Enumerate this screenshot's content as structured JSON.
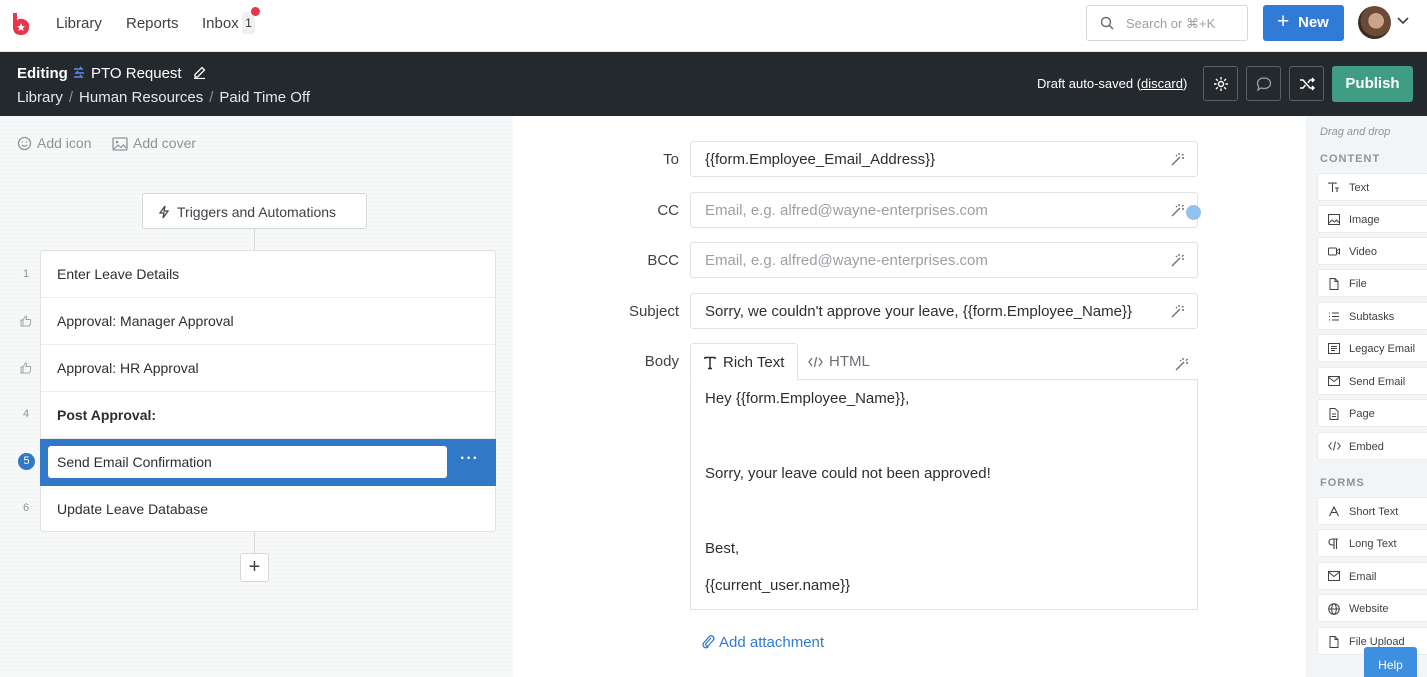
{
  "topnav": {
    "links": [
      "Library",
      "Reports",
      "Inbox"
    ],
    "inbox_count": "1",
    "search_placeholder": "Search or ⌘+K",
    "new_label": "New"
  },
  "editor_header": {
    "mode": "Editing",
    "title": "PTO Request",
    "breadcrumbs": [
      "Library",
      "Human Resources",
      "Paid Time Off"
    ],
    "autosave_text": "Draft auto-saved (",
    "discard_label": "discard",
    "autosave_close": ")",
    "publish_label": "Publish"
  },
  "left": {
    "add_icon_label": "Add icon",
    "add_cover_label": "Add cover",
    "triggers_label": "Triggers and Automations",
    "steps": [
      {
        "num": "1",
        "label": "Enter Leave Details"
      },
      {
        "num": "",
        "label": "Approval: Manager Approval",
        "icon": "thumbs-up-icon"
      },
      {
        "num": "",
        "label": "Approval: HR Approval",
        "icon": "thumbs-up-icon"
      },
      {
        "num": "4",
        "label": "Post Approval:"
      },
      {
        "num": "5",
        "label": "Send Email Confirmation"
      },
      {
        "num": "6",
        "label": "Update Leave Database"
      }
    ],
    "active_more": "···"
  },
  "email": {
    "to_label": "To",
    "to_value": "{{form.Employee_Email_Address}}",
    "cc_label": "CC",
    "cc_placeholder": "Email, e.g. alfred@wayne-enterprises.com",
    "bcc_label": "BCC",
    "bcc_placeholder": "Email, e.g. alfred@wayne-enterprises.com",
    "subject_label": "Subject",
    "subject_value": "Sorry, we couldn't approve your leave, {{form.Employee_Name}}",
    "body_label": "Body",
    "tab_rich": "Rich Text",
    "tab_html": "HTML",
    "body_lines": [
      "Hey {{form.Employee_Name}},",
      "Sorry, your leave could not been approved!",
      "Best,",
      "{{current_user.name}}"
    ],
    "attachment_label": "Add attachment"
  },
  "palette": {
    "hint": "Drag and drop",
    "content_title": "CONTENT",
    "content_items": [
      "Text",
      "Image",
      "Video",
      "File",
      "Subtasks",
      "Legacy Email",
      "Send Email",
      "Page",
      "Embed"
    ],
    "forms_title": "FORMS",
    "form_items": [
      "Short Text",
      "Long Text",
      "Email",
      "Website",
      "File Upload"
    ]
  },
  "help_label": "Help",
  "colors": {
    "brand": "#e5364c",
    "primary": "#2f7bd6",
    "publish": "#3e9d83",
    "header_bg": "#24292e",
    "active_step": "#3178c6"
  }
}
